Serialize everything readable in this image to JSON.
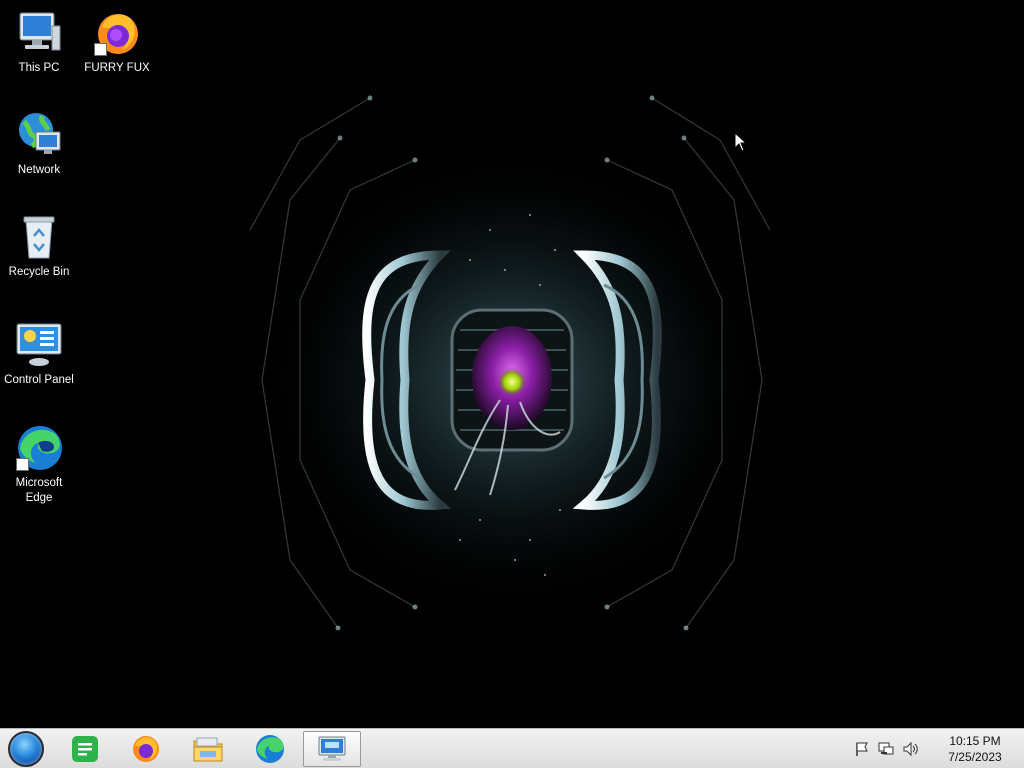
{
  "desktop": {
    "icons": [
      {
        "label": "This PC",
        "icon": "computer-icon"
      },
      {
        "label": "FURRY FUX",
        "icon": "firefox-icon"
      },
      {
        "label": "Network",
        "icon": "network-globe-icon"
      },
      {
        "label": "Recycle Bin",
        "icon": "recycle-bin-icon"
      },
      {
        "label": "Control Panel",
        "icon": "control-panel-icon"
      },
      {
        "label": "Microsoft Edge",
        "icon": "edge-icon"
      }
    ]
  },
  "taskbar": {
    "start": {
      "icon": "start-orb-icon"
    },
    "apps": [
      {
        "icon": "notes-app-icon",
        "active": false
      },
      {
        "icon": "firefox-icon",
        "active": false
      },
      {
        "icon": "file-explorer-icon",
        "active": false
      },
      {
        "icon": "edge-icon",
        "active": false
      },
      {
        "icon": "remote-desktop-icon",
        "active": true
      }
    ],
    "tray": {
      "icons": [
        "flag-icon",
        "network-icon",
        "speaker-icon"
      ],
      "time": "10:15 PM",
      "date": "7/25/2023"
    }
  },
  "colors": {
    "taskbar": "#e6e6e6",
    "accent_blue": "#1a73d9",
    "wallpaper_glow": "#bfe6f0",
    "core_purple": "#b02ad0",
    "core_green": "#b8e600"
  }
}
